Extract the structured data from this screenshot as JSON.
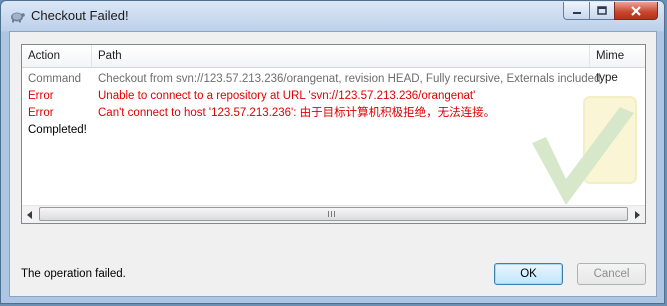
{
  "window": {
    "title": "Checkout Failed!"
  },
  "list": {
    "columns": {
      "action": "Action",
      "path": "Path",
      "mime": "Mime type"
    },
    "rows": [
      {
        "action": "Command",
        "path": "Checkout from svn://123.57.213.236/orangenat, revision HEAD, Fully recursive, Externals included",
        "kind": "command"
      },
      {
        "action": "Error",
        "path": "Unable to connect to a repository at URL 'svn://123.57.213.236/orangenat'",
        "kind": "error"
      },
      {
        "action": "Error",
        "path": "Can't connect to host '123.57.213.236': 由于目标计算机积极拒绝，无法连接。",
        "kind": "error"
      },
      {
        "action": "Completed!",
        "path": "",
        "kind": "done"
      }
    ]
  },
  "status": {
    "message": "The operation failed."
  },
  "buttons": {
    "ok": "OK",
    "cancel": "Cancel"
  },
  "colors": {
    "error": "#e00000",
    "command": "#6d6d6d",
    "accent": "#3c7fb1"
  },
  "icons": {
    "app": "tortoise-icon",
    "watermark": "checkmark-watermark-icon",
    "minimize": "minimize-icon",
    "maximize": "maximize-icon",
    "close": "close-icon"
  }
}
